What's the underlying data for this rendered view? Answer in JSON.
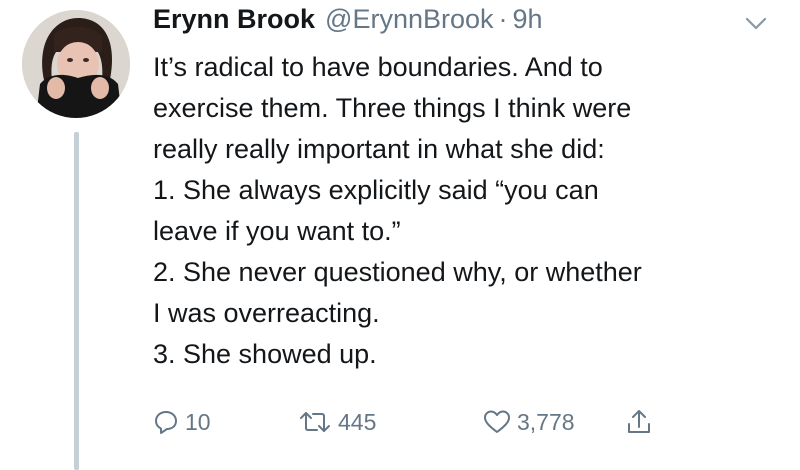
{
  "tweet": {
    "author": {
      "display_name": "Erynn Brook",
      "handle": "@ErynnBrook",
      "separator": "·",
      "time": "9h",
      "avatar_icon": "profile-photo"
    },
    "menu_icon": "chevron-down-icon",
    "lines": [
      "It’s radical to have boundaries. And to",
      "exercise them. Three things I think were",
      "really really important in what she did:",
      "1. She always explicitly said “you can",
      "leave if you want to.”",
      "2. She never questioned why, or whether",
      "I was overreacting.",
      "3. She showed up."
    ],
    "actions": {
      "reply": {
        "icon": "reply-icon",
        "count": "10"
      },
      "retweet": {
        "icon": "retweet-icon",
        "count": "445"
      },
      "like": {
        "icon": "heart-icon",
        "count": "3,778"
      },
      "share": {
        "icon": "share-icon"
      }
    }
  },
  "colors": {
    "text": "#14171a",
    "secondary": "#657786",
    "thread_line": "#c4cfd6"
  }
}
